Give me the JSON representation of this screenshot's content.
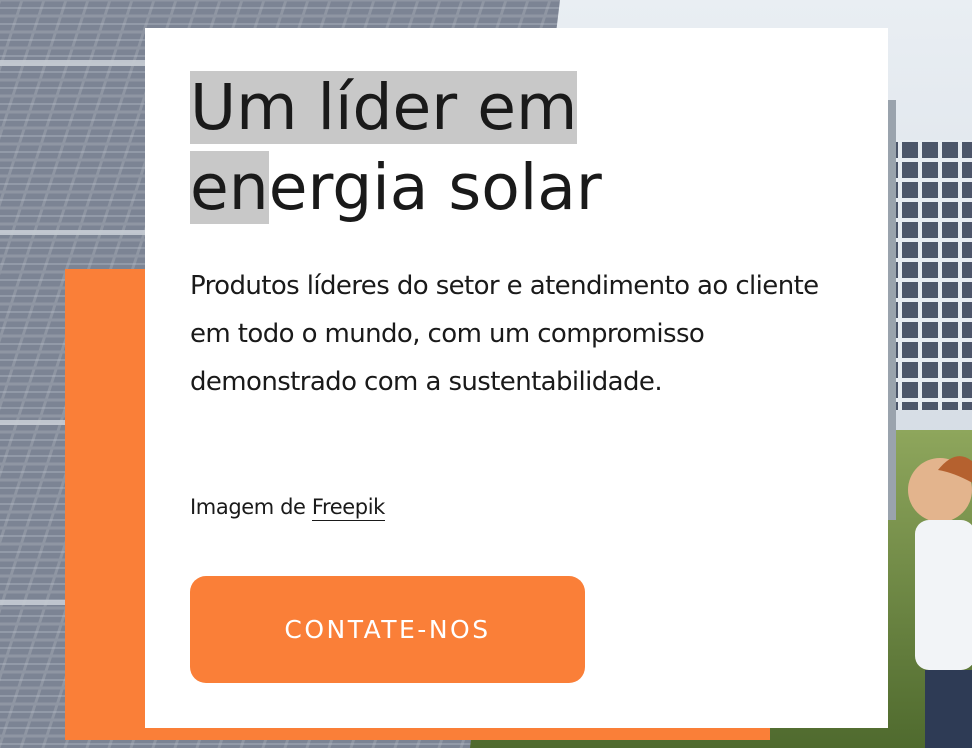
{
  "hero": {
    "title_line1": "Um líder em",
    "title_line2_highlight": "en",
    "title_line2_rest": "ergia solar",
    "lead": "Produtos líderes do setor e atendimento ao cliente em todo o mundo, com um compromisso demonstrado com a sustentabilidade.",
    "credit_prefix": "Imagem de ",
    "credit_link": "Freepik",
    "cta_label": "CONTATE-NOS"
  },
  "colors": {
    "accent": "#fa7f38",
    "card": "#ffffff",
    "text": "#1a1a1a",
    "selection": "#c8c8c8"
  },
  "background": {
    "image": "solar-panels-field-photo"
  }
}
